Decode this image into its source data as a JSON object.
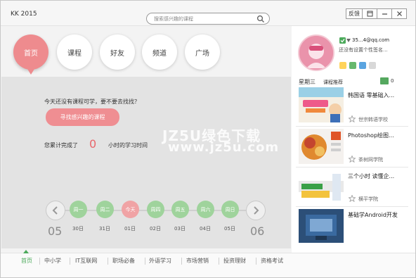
{
  "window": {
    "title": "KK 2015",
    "feedback_label": "反馈"
  },
  "search": {
    "placeholder": "搜索感兴趣的课程"
  },
  "nav": [
    {
      "label": "首页",
      "active": true
    },
    {
      "label": "课程",
      "active": false
    },
    {
      "label": "好友",
      "active": false
    },
    {
      "label": "频道",
      "active": false
    },
    {
      "label": "广场",
      "active": false
    }
  ],
  "main": {
    "prompt": "今天还没有课程可学，要不要去找找？",
    "cta_label": "寻找感兴趣的课程",
    "study_prefix": "您累计完成了",
    "study_hours": "0",
    "study_suffix": "小时的学习时间"
  },
  "week": {
    "start_month": "05",
    "end_month": "06",
    "days": [
      {
        "label": "周一",
        "date": "30日",
        "today": false
      },
      {
        "label": "周二",
        "date": "31日",
        "today": false
      },
      {
        "label": "今天",
        "date": "01日",
        "today": true
      },
      {
        "label": "周四",
        "date": "02日",
        "today": false
      },
      {
        "label": "周五",
        "date": "03日",
        "today": false
      },
      {
        "label": "周六",
        "date": "04日",
        "today": false
      },
      {
        "label": "周日",
        "date": "05日",
        "today": false
      }
    ]
  },
  "categories": [
    "首页",
    "中小学",
    "IT互联网",
    "职场必备",
    "外语学习",
    "市场营销",
    "投资理财",
    "资格考试"
  ],
  "user": {
    "email": "35...4@qq.com",
    "signature": "还没有设置个性签名..."
  },
  "recommend": {
    "weekday": "星期三",
    "subtitle": "课程推荐",
    "count": "0",
    "courses": [
      {
        "title": "韩国语 零基础入...",
        "school": "世宗韩语学校"
      },
      {
        "title": "Photoshop绘图...",
        "school": "茶树网学院"
      },
      {
        "title": "三个小时 读懂企...",
        "school": "横平学院"
      },
      {
        "title": "基础学Android开发",
        "school": ""
      }
    ]
  },
  "watermark": {
    "line1": "JZ5U绿色下载",
    "line2": "www.jz5u.com"
  },
  "colors": {
    "accent_pink": "#ef8e92",
    "day_green": "#9fd39c",
    "accent_green": "#4caa5b"
  }
}
